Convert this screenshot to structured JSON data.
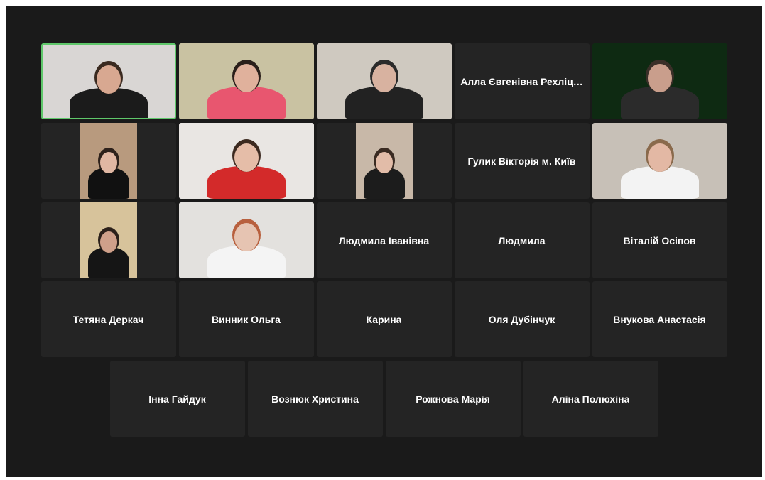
{
  "participants": [
    {
      "id": "p1",
      "name": "",
      "video": true,
      "active": true,
      "bg": "#d9d6d4",
      "skin": "#d8a891",
      "hair": "#3a2a20",
      "shirt": "#1b1b1b"
    },
    {
      "id": "p2",
      "name": "",
      "video": true,
      "bg": "#c9c2a2",
      "skin": "#e0b19c",
      "hair": "#2a1f1a",
      "shirt": "#e8566f"
    },
    {
      "id": "p3",
      "name": "",
      "video": true,
      "bg": "#cfc9c0",
      "skin": "#d8b2a0",
      "hair": "#2b2b2b",
      "shirt": "#222222"
    },
    {
      "id": "p4",
      "name": "Алла Євгенівна Рехліц…",
      "video": false
    },
    {
      "id": "p5",
      "name": "",
      "video": true,
      "bg": "#0e2a12",
      "skin": "#c99e8c",
      "hair": "#3a2f28",
      "shirt": "#2b2b2b"
    },
    {
      "id": "p6",
      "name": "",
      "video": true,
      "narrow": true,
      "bg": "#b89a7e",
      "skin": "#e0b7a3",
      "hair": "#2d211b",
      "shirt": "#111111"
    },
    {
      "id": "p7",
      "name": "",
      "video": true,
      "bg": "#e9e6e3",
      "skin": "#e5bda8",
      "hair": "#3c2a20",
      "shirt": "#d32a2a"
    },
    {
      "id": "p8",
      "name": "",
      "video": true,
      "narrow": true,
      "bg": "#c8b8a8",
      "skin": "#e2bca8",
      "hair": "#3a2b22",
      "shirt": "#1c1c1c"
    },
    {
      "id": "p9",
      "name": "Гулик Вікторія м. Київ",
      "video": false
    },
    {
      "id": "p10",
      "name": "",
      "video": true,
      "bg": "#c7c0b7",
      "skin": "#e3b8a4",
      "hair": "#8a6a4c",
      "shirt": "#f3f3f3"
    },
    {
      "id": "p11",
      "name": "",
      "video": true,
      "narrow": true,
      "bg": "#d7c39b",
      "skin": "#cfa08a",
      "hair": "#2b201a",
      "shirt": "#151515"
    },
    {
      "id": "p12",
      "name": "",
      "video": true,
      "bg": "#e3e1de",
      "skin": "#e6c4b2",
      "hair": "#b8603e",
      "shirt": "#f4f4f4"
    },
    {
      "id": "p13",
      "name": "Людмила Іванівна",
      "video": false
    },
    {
      "id": "p14",
      "name": "Людмила",
      "video": false
    },
    {
      "id": "p15",
      "name": "Віталій Осіпов",
      "video": false
    },
    {
      "id": "p16",
      "name": "Тетяна Деркач",
      "video": false
    },
    {
      "id": "p17",
      "name": "Винник Ольга",
      "video": false
    },
    {
      "id": "p18",
      "name": "Карина",
      "video": false
    },
    {
      "id": "p19",
      "name": "Оля Дубінчук",
      "video": false
    },
    {
      "id": "p20",
      "name": "Внукова Анастасія",
      "video": false
    },
    {
      "id": "p21",
      "name": "Інна Гайдук",
      "video": false
    },
    {
      "id": "p22",
      "name": "Вознюк Христина",
      "video": false
    },
    {
      "id": "p23",
      "name": "Рожнова Марія",
      "video": false
    },
    {
      "id": "p24",
      "name": "Аліна Полюхіна",
      "video": false
    }
  ]
}
